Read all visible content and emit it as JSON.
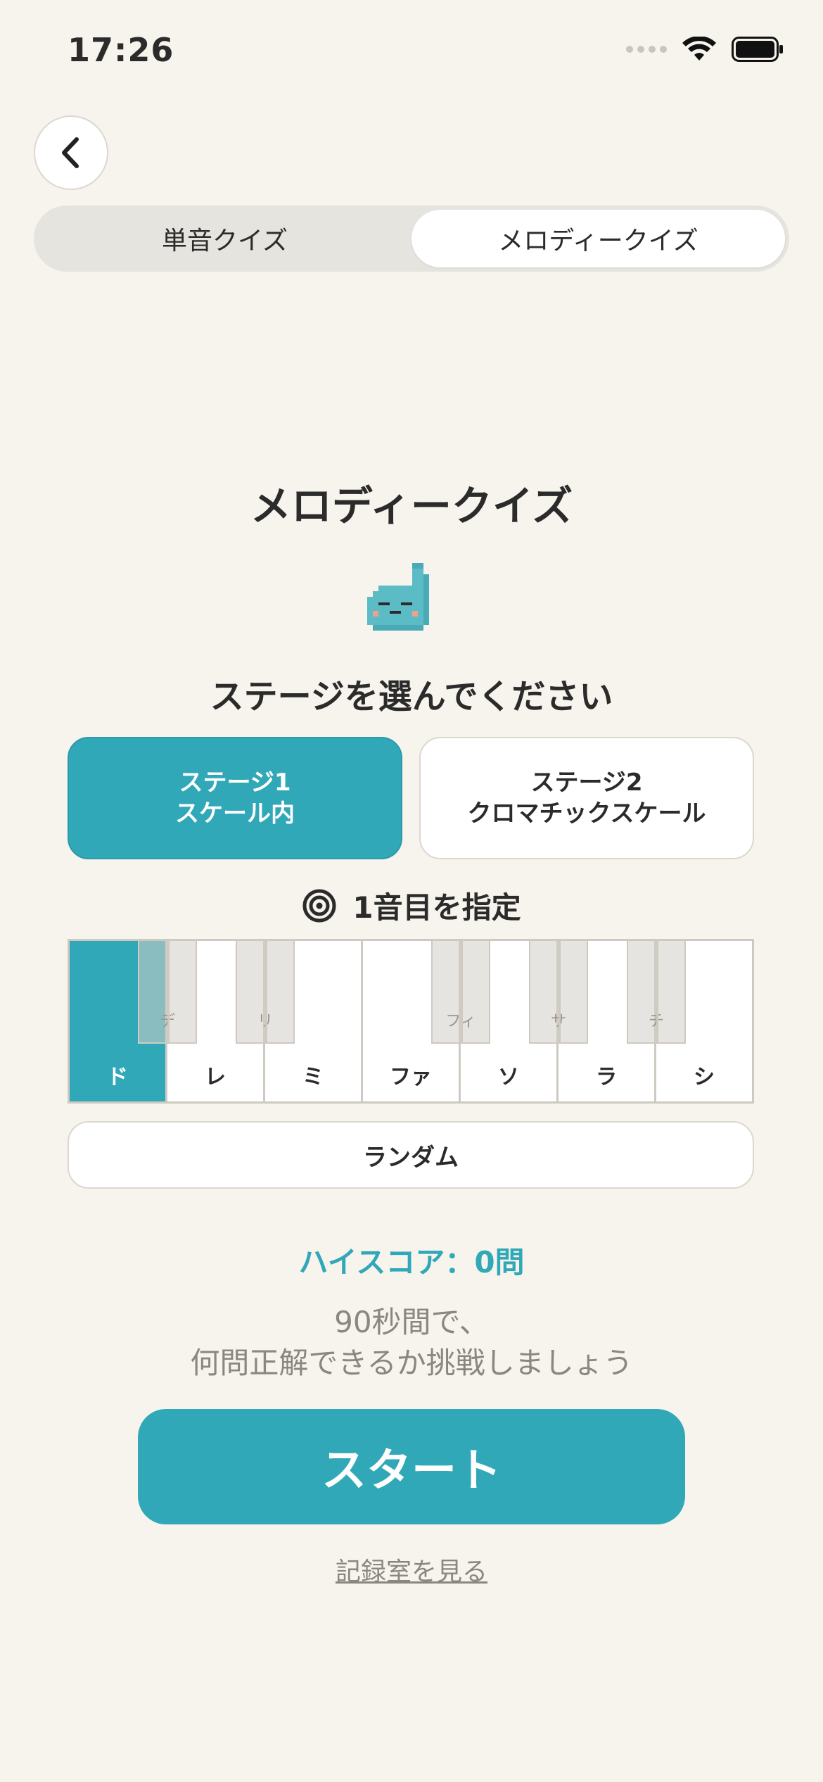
{
  "status_bar": {
    "time": "17:26"
  },
  "tabs": [
    {
      "label": "単音クイズ",
      "active": false
    },
    {
      "label": "メロディークイズ",
      "active": true
    }
  ],
  "title": "メロディークイズ",
  "prompt": "ステージを選んでください",
  "stages": [
    {
      "line1": "ステージ1",
      "line2": "スケール内",
      "selected": true
    },
    {
      "line1": "ステージ2",
      "line2": "クロマチックスケール",
      "selected": false
    }
  ],
  "first_note_label": "1音目を指定",
  "keyboard": {
    "white_keys": [
      "ド",
      "レ",
      "ミ",
      "ファ",
      "ソ",
      "ラ",
      "シ"
    ],
    "black_keys": [
      "デ",
      "リ",
      "フィ",
      "サ",
      "チ"
    ],
    "selected": "ド"
  },
  "random_label": "ランダム",
  "high_score": "ハイスコア：0問",
  "description": {
    "line1": "90秒間で、",
    "line2": "何問正解できるか挑戦しましょう"
  },
  "start_label": "スタート",
  "records_link": "記録室を見る",
  "colors": {
    "accent": "#31a8b8",
    "background": "#f7f4ed"
  },
  "icons": [
    "back-chevron-icon",
    "signal-icon",
    "wifi-icon",
    "battery-icon",
    "target-icon",
    "mascot-icon"
  ]
}
